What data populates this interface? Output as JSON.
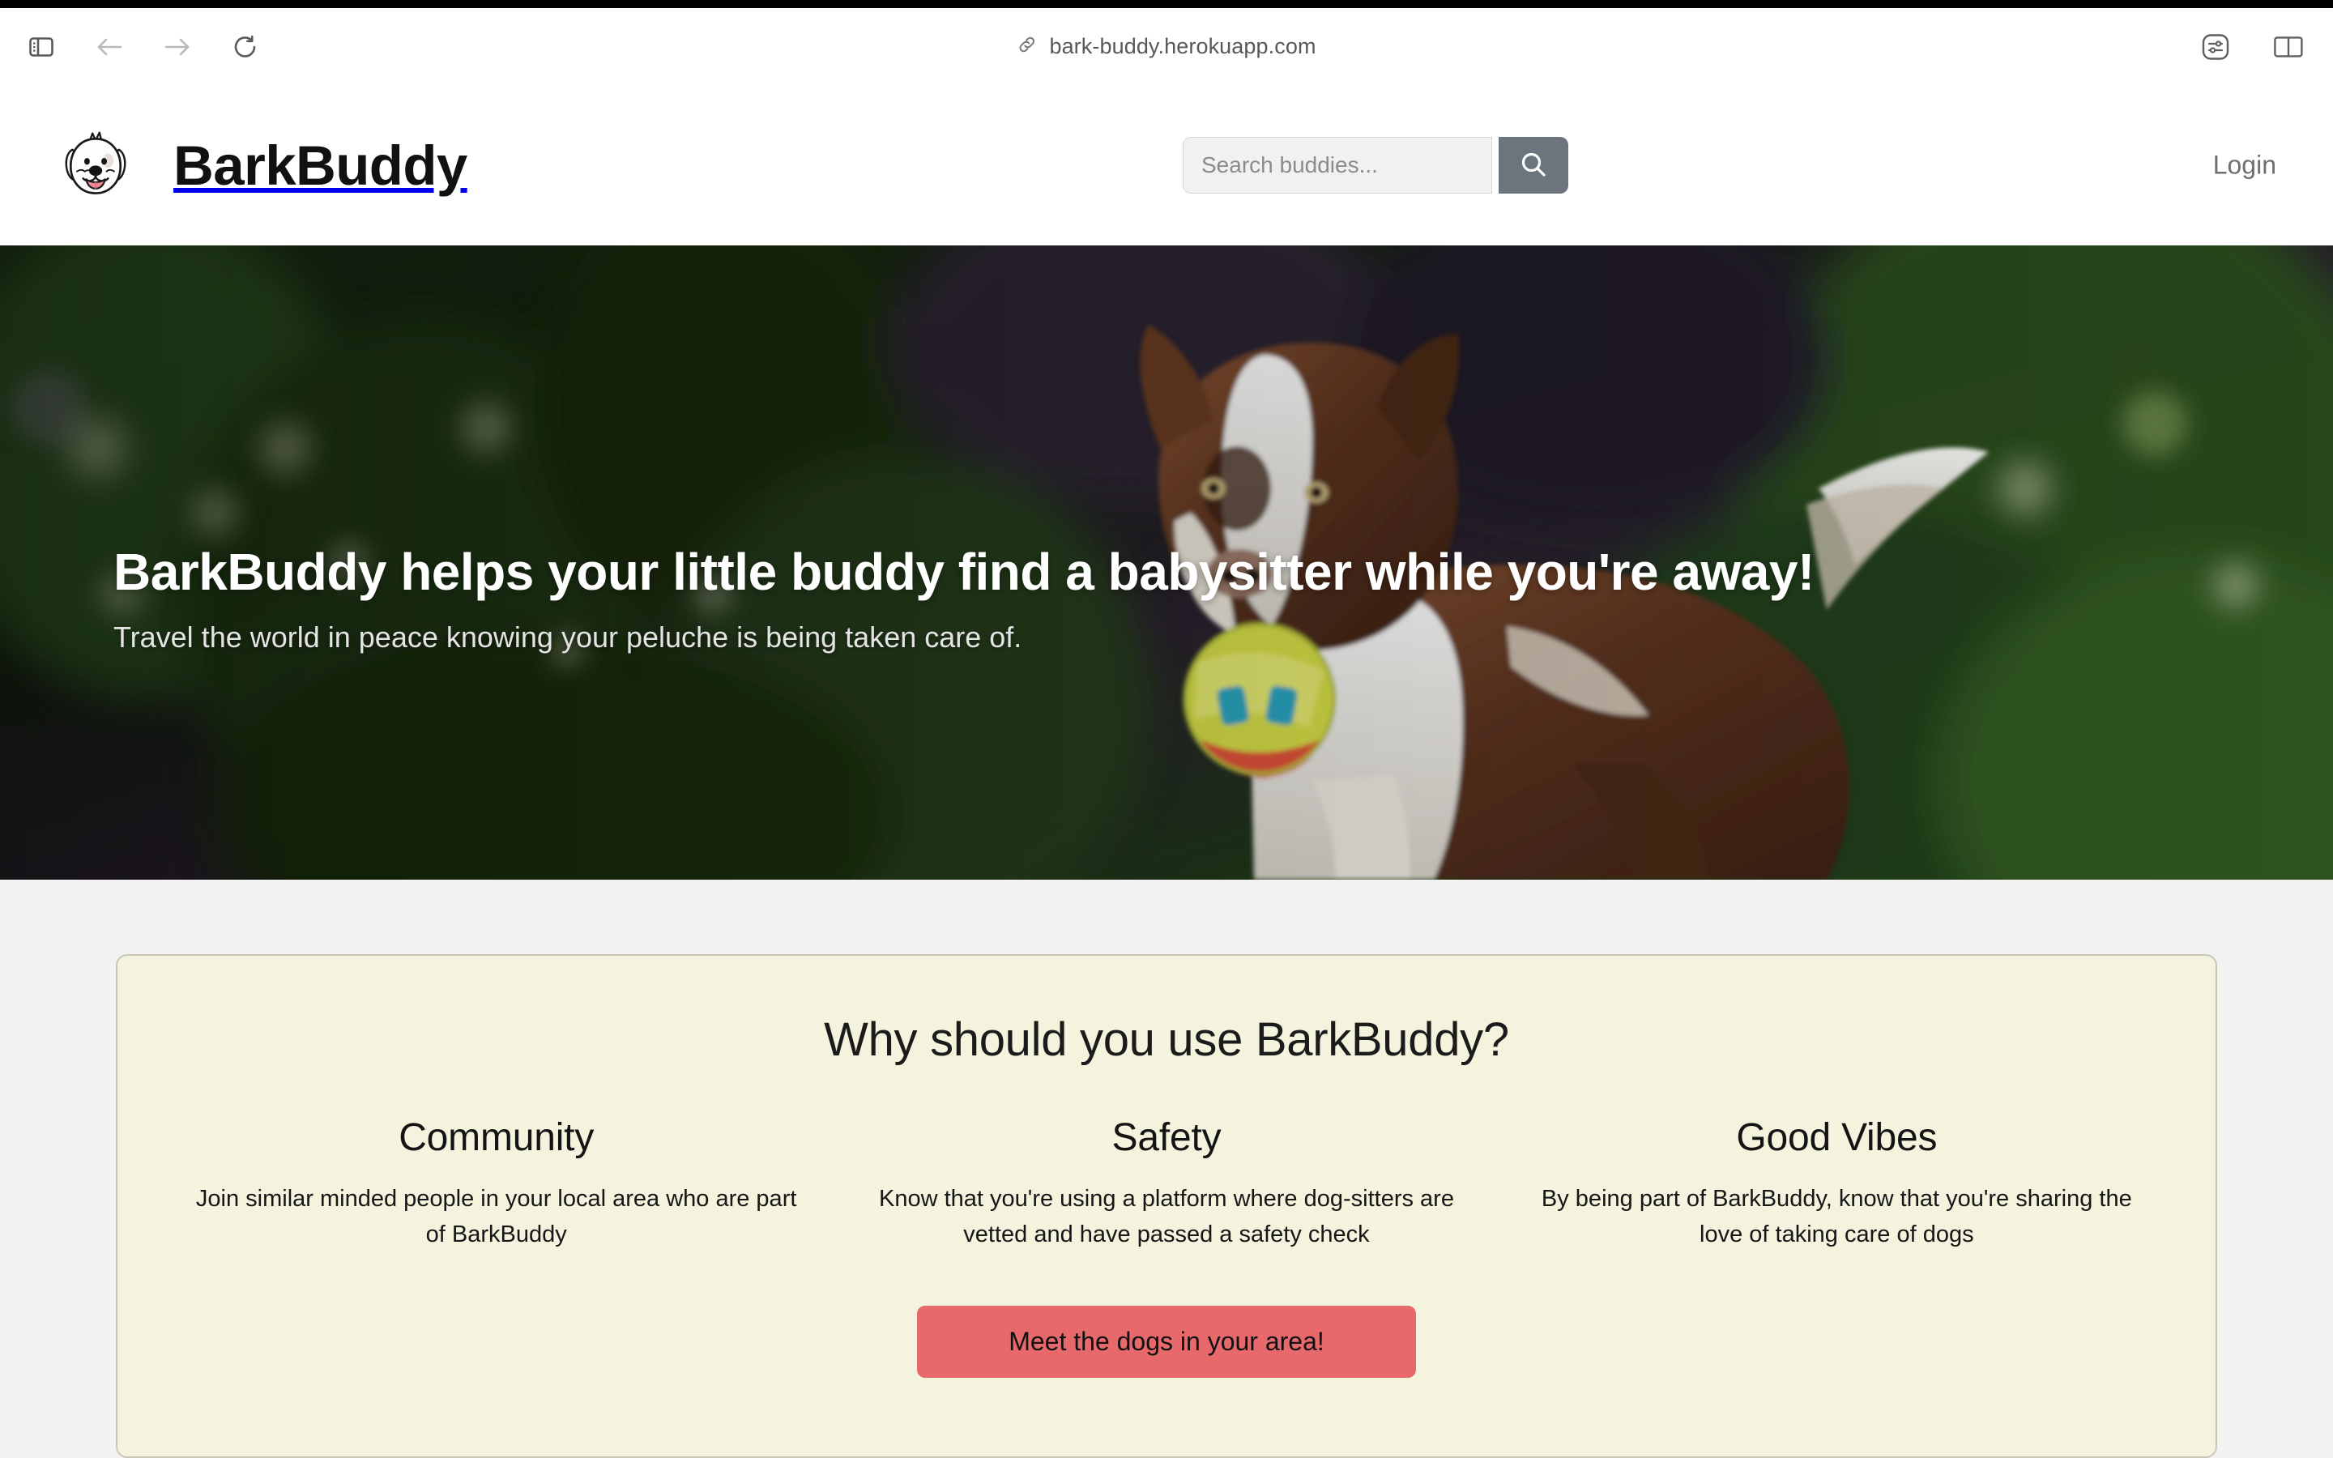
{
  "browser": {
    "url": "bark-buddy.herokuapp.com",
    "url_icon": "link-icon",
    "back_label": "Back",
    "forward_label": "Forward",
    "reload_label": "Reload",
    "sidebar_toggle_label": "Show Sidebar",
    "reader_label": "Page Settings",
    "tab_overview_label": "Tab Overview"
  },
  "header": {
    "brand_name": "BarkBuddy",
    "logo_icon": "dog-face-logo",
    "search": {
      "placeholder": "Search buddies...",
      "value": "",
      "button_icon": "search-icon",
      "button_color": "#6c757d"
    },
    "login_label": "Login"
  },
  "hero": {
    "title": "BarkBuddy helps your little buddy find a babysitter while you're away!",
    "subtitle": "Travel the world in peace knowing your peluche is being taken care of.",
    "image_alt": "Brown and white border collie carrying a colorful ball in a garden"
  },
  "why": {
    "title": "Why should you use BarkBuddy?",
    "card_background": "#f4f3dd",
    "columns": [
      {
        "title": "Community",
        "body": "Join similar minded people in your local area who are part of BarkBuddy"
      },
      {
        "title": "Safety",
        "body": "Know that you're using a platform where dog-sitters are vetted and have passed a safety check"
      },
      {
        "title": "Good Vibes",
        "body": "By being part of BarkBuddy, know that you're sharing the love of taking care of dogs"
      }
    ],
    "cta_label": "Meet the dogs in your area!",
    "cta_color": "#e8696b"
  }
}
